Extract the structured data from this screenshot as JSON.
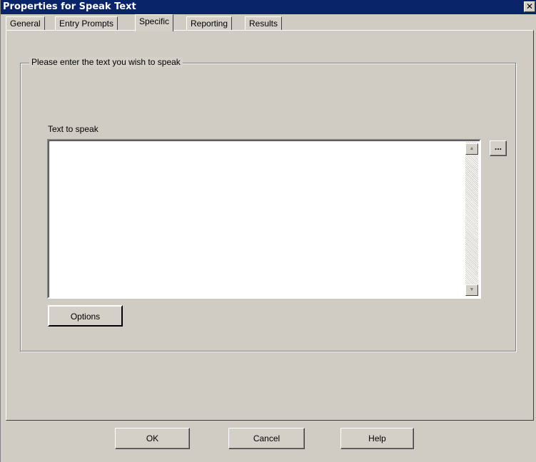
{
  "window": {
    "title": "Properties for Speak Text",
    "close_glyph": "✕"
  },
  "tabs": [
    {
      "label": "General",
      "active": false
    },
    {
      "label": "Entry Prompts",
      "active": false
    },
    {
      "label": "Specific",
      "active": true
    },
    {
      "label": "Reporting",
      "active": false
    },
    {
      "label": "Results",
      "active": false
    }
  ],
  "group": {
    "legend": "Please enter the text you wish to speak",
    "text_label": "Text to speak",
    "text_value": "",
    "browse_label": "...",
    "options_label": "Options"
  },
  "footer": {
    "ok_label": "OK",
    "cancel_label": "Cancel",
    "help_label": "Help"
  },
  "colors": {
    "titlebar": "#0a246a",
    "dialog_face": "#d4d0c8"
  }
}
